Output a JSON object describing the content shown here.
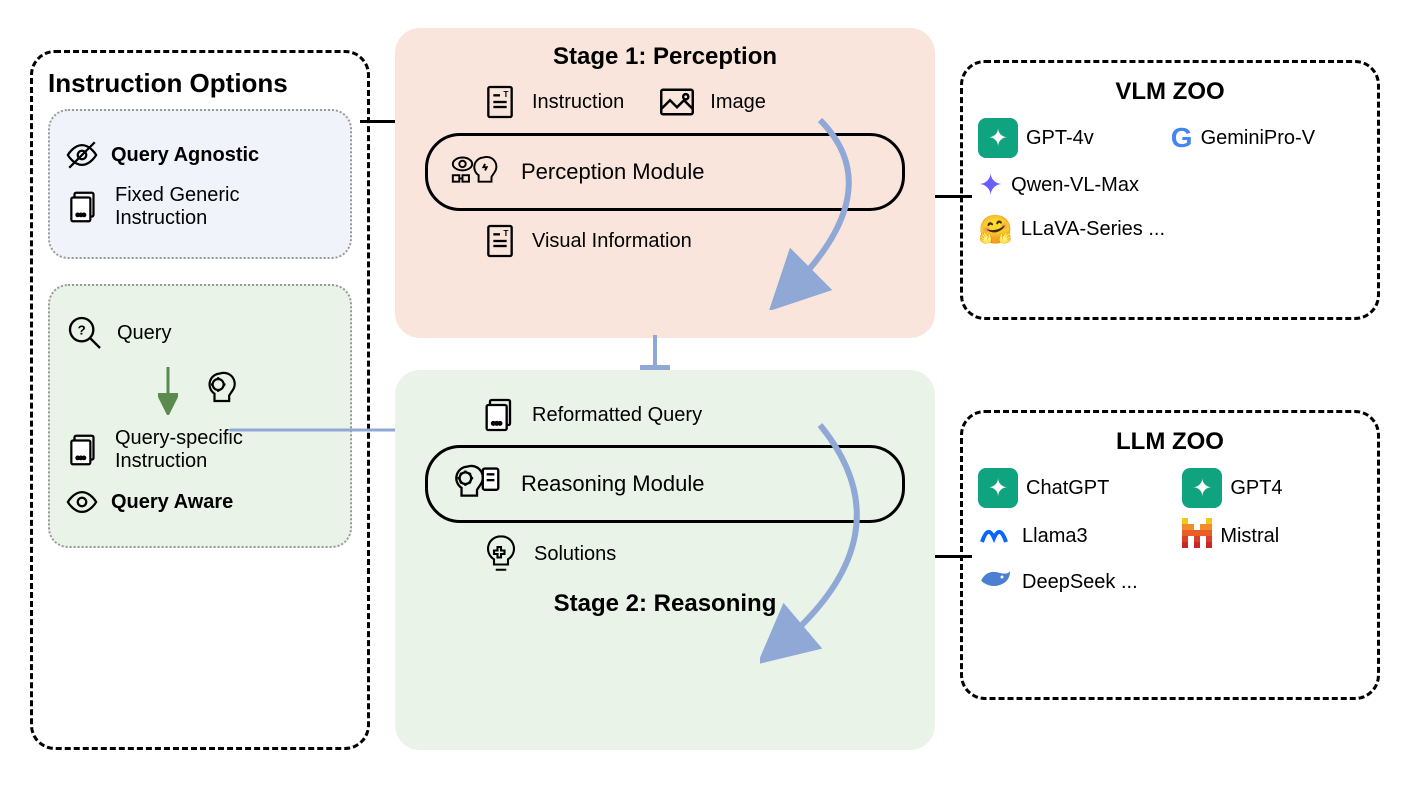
{
  "instruction_options": {
    "title": "Instruction Options",
    "query_agnostic": {
      "heading": "Query Agnostic",
      "sub": "Fixed Generic Instruction"
    },
    "query_aware": {
      "query": "Query",
      "sub": "Query-specific Instruction",
      "heading": "Query Aware"
    }
  },
  "stage1": {
    "title": "Stage 1: Perception",
    "instruction": "Instruction",
    "image": "Image",
    "module": "Perception Module",
    "visual_info": "Visual Information"
  },
  "stage2": {
    "ref_query": "Reformatted Query",
    "module": "Reasoning Module",
    "solutions": "Solutions",
    "title": "Stage 2: Reasoning"
  },
  "vlm_zoo": {
    "title": "VLM ZOO",
    "items": [
      "GPT-4v",
      "GeminiPro-V",
      "Qwen-VL-Max",
      "LLaVA-Series ..."
    ]
  },
  "llm_zoo": {
    "title": "LLM ZOO",
    "items": [
      "ChatGPT",
      "GPT4",
      "Llama3",
      "Mistral",
      "DeepSeek ..."
    ]
  }
}
